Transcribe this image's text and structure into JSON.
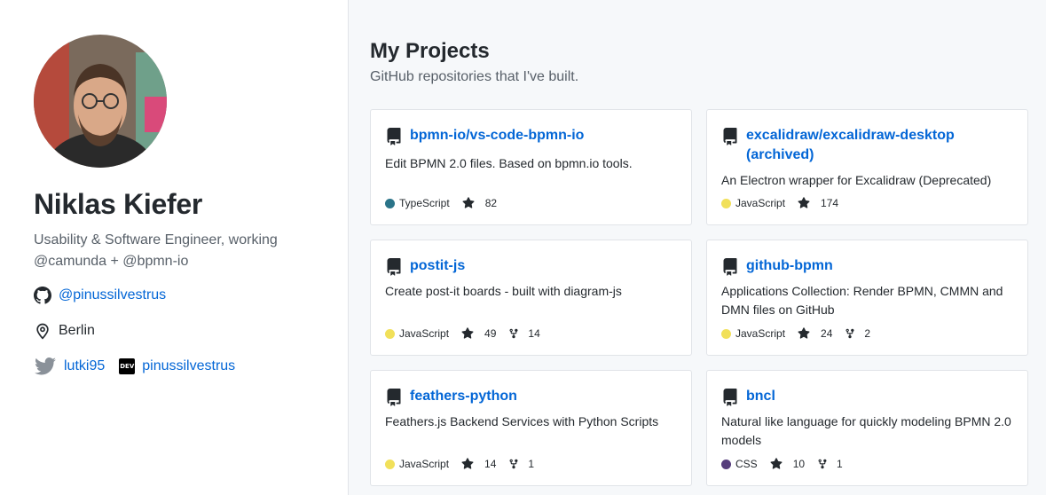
{
  "profile": {
    "name": "Niklas Kiefer",
    "bio": "Usability & Software Engineer, working @camunda + @bpmn-io",
    "github": "@pinussilvestrus",
    "location": "Berlin",
    "twitter": "lutki95",
    "dev": "pinussilvestrus",
    "dev_badge": "DEV"
  },
  "main": {
    "title": "My Projects",
    "subtitle": "GitHub repositories that I've built."
  },
  "colors": {
    "link": "#0366d6",
    "TypeScript": "#2b7489",
    "JavaScript": "#f1e05a",
    "CSS": "#563d7c"
  },
  "projects": [
    {
      "name": "bpmn-io/vs-code-bpmn-io",
      "description": "Edit BPMN 2.0 files. Based on bpmn.io tools.",
      "language": "TypeScript",
      "stars": "82",
      "forks": ""
    },
    {
      "name": "excalidraw/excalidraw-desktop (archived)",
      "description": "An Electron wrapper for Excalidraw (Deprecated)",
      "language": "JavaScript",
      "stars": "174",
      "forks": ""
    },
    {
      "name": "postit-js",
      "description": "Create post-it boards - built with diagram-js",
      "language": "JavaScript",
      "stars": "49",
      "forks": "14"
    },
    {
      "name": "github-bpmn",
      "description": "Applications Collection: Render BPMN, CMMN and DMN files on GitHub",
      "language": "JavaScript",
      "stars": "24",
      "forks": "2"
    },
    {
      "name": "feathers-python",
      "description": "Feathers.js Backend Services with Python Scripts",
      "language": "JavaScript",
      "stars": "14",
      "forks": "1"
    },
    {
      "name": "bncl",
      "description": "Natural like language for quickly modeling BPMN 2.0 models",
      "language": "CSS",
      "stars": "10",
      "forks": "1"
    }
  ]
}
